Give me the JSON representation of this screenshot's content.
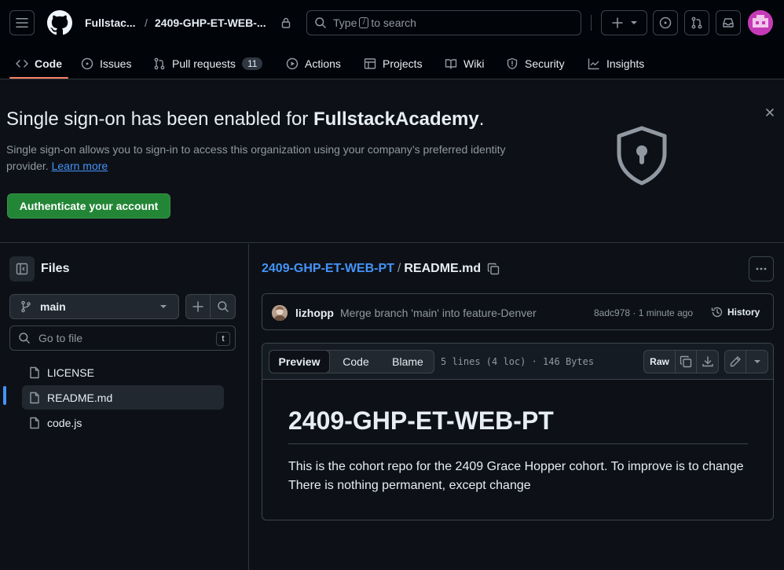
{
  "header": {
    "org": "Fullstac...",
    "separator": "/",
    "repo": "2409-GHP-ET-WEB-...",
    "search_prefix": "Type",
    "search_key": "/",
    "search_suffix": "to search"
  },
  "tabs": [
    {
      "label": "Code",
      "active": true
    },
    {
      "label": "Issues"
    },
    {
      "label": "Pull requests",
      "count": "11"
    },
    {
      "label": "Actions"
    },
    {
      "label": "Projects"
    },
    {
      "label": "Wiki"
    },
    {
      "label": "Security"
    },
    {
      "label": "Insights"
    }
  ],
  "banner": {
    "title_prefix": "Single sign-on has been enabled for ",
    "org_name": "FullstackAcademy",
    "title_suffix": ".",
    "description": "Single sign-on allows you to sign-in to access this organization using your company’s preferred identity provider.",
    "learn_more": "Learn more",
    "button": "Authenticate your account"
  },
  "sidebar": {
    "title": "Files",
    "branch": "main",
    "goto_placeholder": "Go to file",
    "goto_key": "t",
    "files": [
      {
        "name": "LICENSE"
      },
      {
        "name": "README.md",
        "selected": true
      },
      {
        "name": "code.js"
      }
    ]
  },
  "breadcrumb": {
    "repo": "2409-GHP-ET-WEB-PT",
    "sep": "/",
    "file": "README.md"
  },
  "commit": {
    "author": "lizhopp",
    "message": "Merge branch 'main' into feature-Denver",
    "meta": "8adc978 · 1 minute ago",
    "history": "History"
  },
  "file_view": {
    "tabs": [
      "Preview",
      "Code",
      "Blame"
    ],
    "info": "5 lines (4 loc) · 146 Bytes",
    "raw": "Raw"
  },
  "readme": {
    "heading": "2409-GHP-ET-WEB-PT",
    "body": "This is the cohort repo for the 2409 Grace Hopper cohort. To improve is to change There is nothing permanent, except change"
  },
  "colors": {
    "accent": "#4493f8",
    "primary_button": "#238636",
    "tab_underline": "#f78166",
    "background": "#0d1117"
  }
}
